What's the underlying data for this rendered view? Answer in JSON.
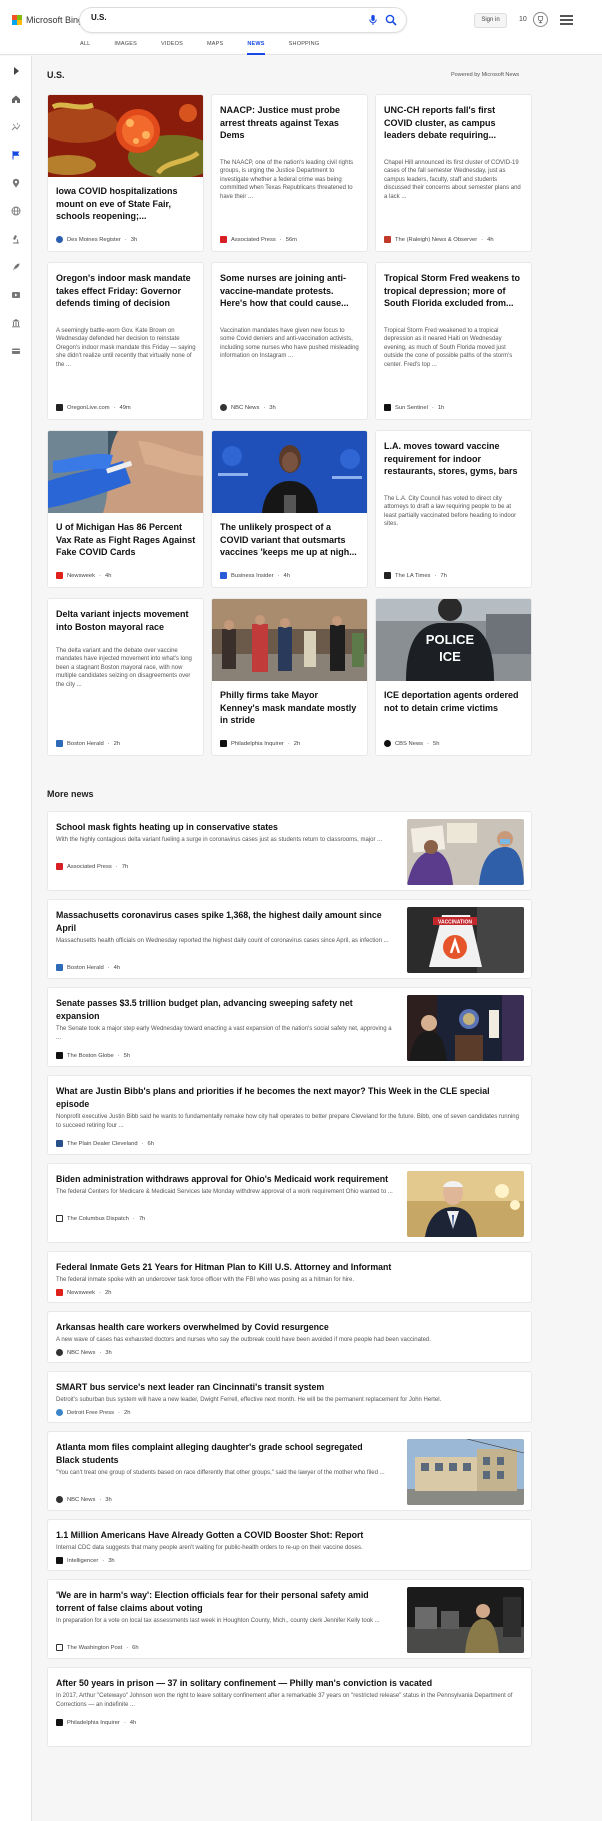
{
  "header": {
    "brand": "Microsoft Bing",
    "search_value": "U.S.",
    "signin_label": "Sign in",
    "rewards_count": "10"
  },
  "tabs": [
    "ALL",
    "IMAGES",
    "VIDEOS",
    "MAPS",
    "NEWS",
    "SHOPPING"
  ],
  "section": {
    "title": "U.S.",
    "powered_by": "Powered by Microsoft News"
  },
  "cards": [
    {
      "title": "Iowa COVID hospitalizations mount on eve of State Fair, schools reopening;...",
      "desc": "",
      "source": "Des Moines Register",
      "time": "3h"
    },
    {
      "title": "NAACP: Justice must probe arrest threats against Texas Dems",
      "desc": "The NAACP, one of the nation's leading civil rights groups, is urging the Justice Department to investigate whether a federal crime was being committed when Texas Republicans threatened to have their ...",
      "source": "Associated Press",
      "time": "56m"
    },
    {
      "title": "UNC-CH reports fall's first COVID cluster, as campus leaders debate requiring...",
      "desc": "Chapel Hill announced its first cluster of COVID-19 cases of the fall semester Wednesday, just as campus leaders, faculty, staff and students discussed their concerns about semester plans and a lack ...",
      "source": "The (Raleigh) News & Observer",
      "time": "4h"
    },
    {
      "title": "Oregon's indoor mask mandate takes effect Friday: Governor defends timing of decision",
      "desc": "A seemingly battle-worn Gov. Kate Brown on Wednesday defended her decision to reinstate Oregon's indoor mask mandate this Friday — saying she didn't realize until recently that virtually none of the ...",
      "source": "OregonLive.com",
      "time": "49m"
    },
    {
      "title": "Some nurses are joining anti-vaccine-mandate protests. Here's how that could cause...",
      "desc": "Vaccination mandates have given new focus to some Covid deniers and anti-vaccination activists, including some nurses who have pushed misleading information on Instagram ...",
      "source": "NBC News",
      "time": "3h"
    },
    {
      "title": "Tropical Storm Fred weakens to tropical depression; more of South Florida excluded from...",
      "desc": "Tropical Storm Fred weakened to a tropical depression as it neared Haiti on Wednesday evening, as much of South Florida moved just outside the cone of possible paths of the storm's center. Fred's top ...",
      "source": "Sun Sentinel",
      "time": "1h"
    },
    {
      "title": "U of Michigan Has 86 Percent Vax Rate as Fight Rages Against Fake COVID Cards",
      "desc": "",
      "source": "Newsweek",
      "time": "4h"
    },
    {
      "title": "The unlikely prospect of a COVID variant that outsmarts vaccines 'keeps me up at nigh...",
      "desc": "",
      "source": "Business Insider",
      "time": "4h"
    },
    {
      "title": "L.A. moves toward vaccine requirement for indoor restaurants, stores, gyms, bars",
      "desc": "The L.A. City Council has voted to direct city attorneys to draft a law requiring people to be at least partially vaccinated before heading to indoor sites.",
      "source": "The LA Times",
      "time": "7h"
    },
    {
      "title": "Delta variant injects movement into Boston mayoral race",
      "desc": "The delta variant and the debate over vaccine mandates have injected movement into what's long been a stagnant Boston mayoral race, with now multiple candidates seizing on disagreements over the city ...",
      "source": "Boston Herald",
      "time": "2h"
    },
    {
      "title": "Philly firms take Mayor Kenney's mask mandate mostly in stride",
      "desc": "",
      "source": "Philadelphia Inquirer",
      "time": "2h"
    },
    {
      "title": "ICE deportation agents ordered not to detain crime victims",
      "desc": "",
      "source": "CBS News",
      "time": "5h"
    }
  ],
  "more_news": {
    "title": "More news",
    "items": [
      {
        "title": "School mask fights heating up in conservative states",
        "desc": "With the highly contagious delta variant fueling a surge in coronavirus cases just as students return to classrooms, major ...",
        "source": "Associated Press",
        "time": "7h"
      },
      {
        "title": "Massachusetts coronavirus cases spike 1,368, the highest daily amount since April",
        "desc": "Massachusetts health officials on Wednesday reported the highest daily count of coronavirus cases since April, as infection ...",
        "source": "Boston Herald",
        "time": "4h"
      },
      {
        "title": "Senate passes $3.5 trillion budget plan, advancing sweeping safety net expansion",
        "desc": "The Senate took a major step early Wednesday toward enacting a vast expansion of the nation's social safety net, approving a ...",
        "source": "The Boston Globe",
        "time": "5h"
      },
      {
        "title": "What are Justin Bibb's plans and priorities if he becomes the next mayor? This Week in the CLE special episode",
        "desc": "Nonprofit executive Justin Bibb said he wants to fundamentally remake how city hall operates to better prepare Cleveland for the future. Bibb, one of seven candidates running to succeed retiring four ...",
        "source": "The Plain Dealer Cleveland",
        "time": "6h"
      },
      {
        "title": "Biden administration withdraws approval for Ohio's Medicaid work requirement",
        "desc": "The federal Centers for Medicare & Medicaid Services late Monday withdrew approval of a work requirement Ohio wanted to ...",
        "source": "The Columbus Dispatch",
        "time": "7h"
      },
      {
        "title": "Federal Inmate Gets 21 Years for Hitman Plan to Kill U.S. Attorney and Informant",
        "desc": "The federal inmate spoke with an undercover task force officer with the FBI who was posing as a hitman for hire.",
        "source": "Newsweek",
        "time": "2h"
      },
      {
        "title": "Arkansas health care workers overwhelmed by Covid resurgence",
        "desc": "A new wave of cases has exhausted doctors and nurses who say the outbreak could have been avoided if more people had been vaccinated.",
        "source": "NBC News",
        "time": "3h"
      },
      {
        "title": "SMART bus service's next leader ran Cincinnati's transit system",
        "desc": "Detroit's suburban bus system will have a new leader, Dwight Ferrell, effective next month. He will be the permanent replacement for John Hertel.",
        "source": "Detroit Free Press",
        "time": "2h"
      },
      {
        "title": "Atlanta mom files complaint alleging daughter's grade school segregated Black students",
        "desc": "\"You can't treat one group of students based on race differently that other groups,\" said the lawyer of the mother who filed ...",
        "source": "NBC News",
        "time": "3h"
      },
      {
        "title": "1.1 Million Americans Have Already Gotten a COVID Booster Shot: Report",
        "desc": "Internal CDC data suggests that many people aren't waiting for public-health orders to re-up on their vaccine doses.",
        "source": "Intelligencer",
        "time": "3h"
      },
      {
        "title": "'We are in harm's way': Election officials fear for their personal safety amid torrent of false claims about voting",
        "desc": "In preparation for a vote on local tax assessments last week in Houghton County, Mich., county clerk Jennifer Kelly took ...",
        "source": "The Washington Post",
        "time": "6h"
      },
      {
        "title": "After 50 years in prison — 37 in solitary confinement — Philly man's conviction is vacated",
        "desc": "In 2017, Arthur \"Cetewayo\" Johnson won the right to leave solitary confinement after a remarkable 37 years on \"restricted release\" status in the Pennsylvania Department of Corrections — an indefinite ...",
        "source": "Philadelphia Inquirer",
        "time": "4h"
      }
    ]
  },
  "images": {
    "sign_police": "POLICE",
    "sign_ice": "ICE",
    "sign_vaccination": "VACCINATION"
  },
  "colors": {
    "accent": "#174ae4"
  }
}
